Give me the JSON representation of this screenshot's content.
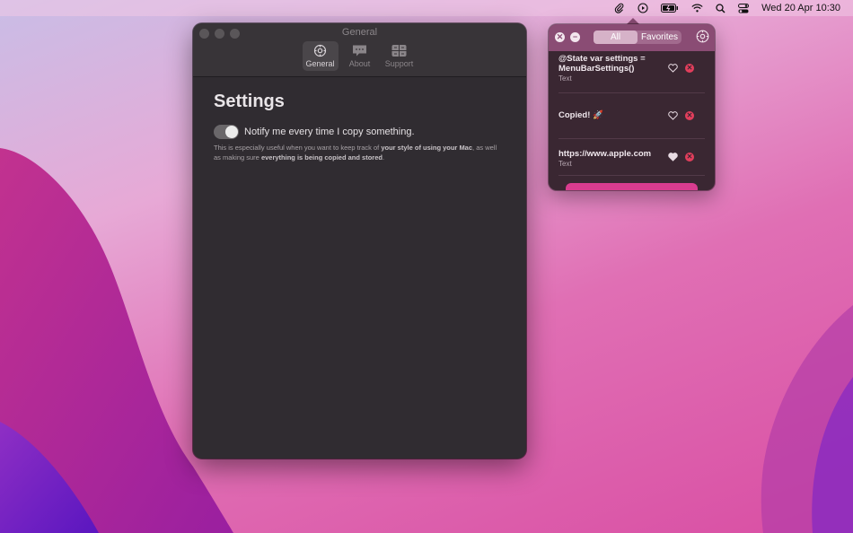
{
  "menubar": {
    "icons": [
      "paperclip-icon",
      "play-circle-icon",
      "battery-icon",
      "wifi-icon",
      "search-icon",
      "control-center-icon"
    ],
    "clock": "Wed 20 Apr  10:30"
  },
  "window": {
    "title": "General",
    "tabs": [
      {
        "label": "General",
        "icon": "gear-icon",
        "active": true
      },
      {
        "label": "About",
        "icon": "speech-bubble-icon",
        "active": false
      },
      {
        "label": "Support",
        "icon": "grid-card-icon",
        "active": false
      }
    ],
    "heading": "Settings",
    "toggle_label": "Notify me every time I copy something.",
    "toggle_on": true,
    "description_part1": "This is especially useful when you want to keep track of ",
    "description_bold1": "your style of using your Mac",
    "description_part2": ", as well as making sure ",
    "description_bold2": "everything is being copied and stored",
    "description_part3": "."
  },
  "popover": {
    "segments": [
      "All",
      "Favorites"
    ],
    "selected_segment": "All",
    "items": [
      {
        "title": "@State var settings = MenuBarSettings()",
        "type": "Text",
        "favorite": false
      },
      {
        "title": "Copied! 🚀",
        "type": "",
        "favorite": false
      },
      {
        "title": "https://www.apple.com",
        "type": "Text",
        "favorite": true
      }
    ]
  },
  "colors": {
    "accent": "#d93c8f",
    "delete": "#e23e5c",
    "popover_header": "#8a4c74"
  }
}
